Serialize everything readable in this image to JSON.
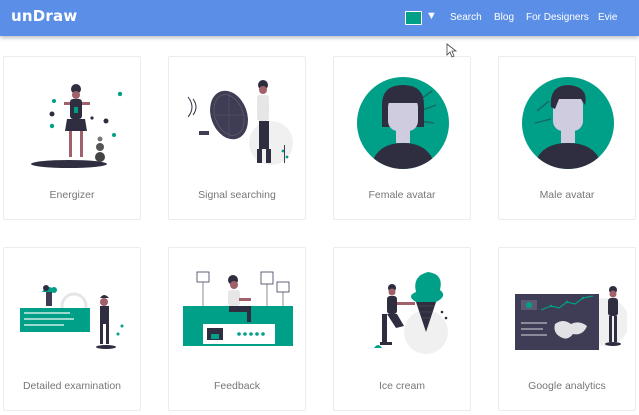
{
  "header": {
    "brand": "unDraw",
    "accent_color": "#00a088",
    "nav": [
      "Search",
      "Blog",
      "For Designers",
      "Evie"
    ]
  },
  "illustrations": [
    {
      "title": "Energizer"
    },
    {
      "title": "Signal searching"
    },
    {
      "title": "Female avatar"
    },
    {
      "title": "Male avatar"
    },
    {
      "title": "Detailed examination"
    },
    {
      "title": "Feedback"
    },
    {
      "title": "Ice cream"
    },
    {
      "title": "Google analytics"
    }
  ],
  "colors": {
    "navbar": "#5b8ee6",
    "accent": "#00a088",
    "dark": "#2f2e41"
  }
}
